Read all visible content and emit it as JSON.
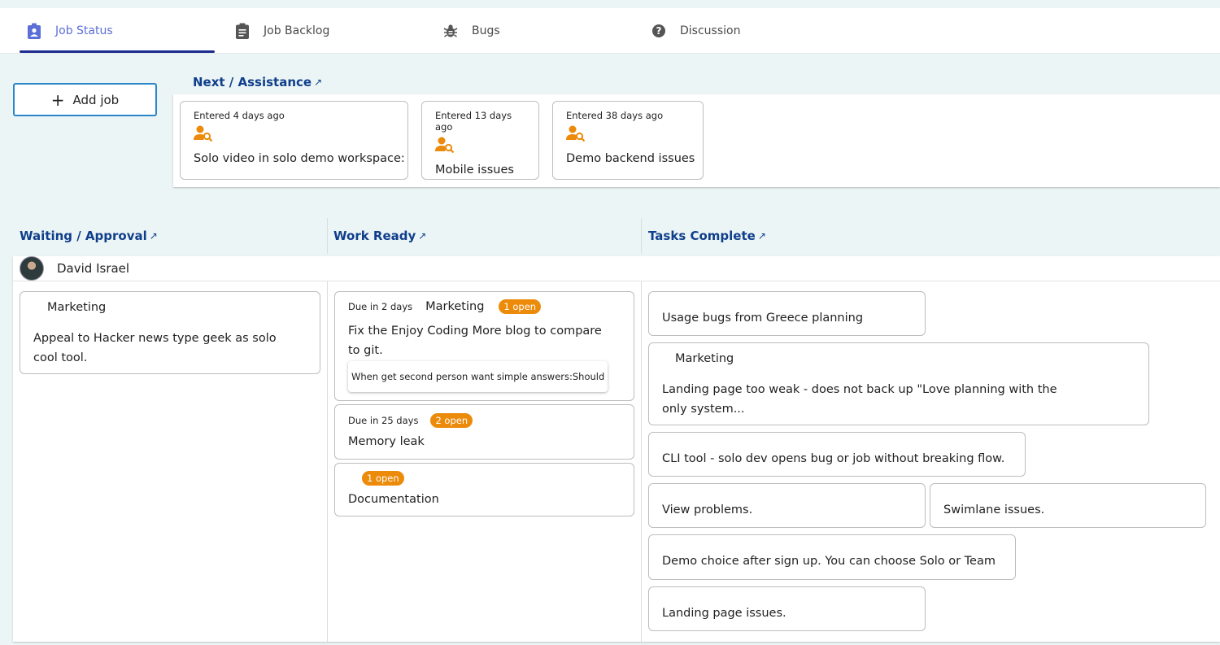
{
  "tabs": [
    {
      "label": "Job Status",
      "icon": "badge-icon",
      "active": true
    },
    {
      "label": "Job Backlog",
      "icon": "clipboard-icon",
      "active": false
    },
    {
      "label": "Bugs",
      "icon": "bug-icon",
      "active": false
    },
    {
      "label": "Discussion",
      "icon": "help-icon",
      "active": false
    }
  ],
  "add_job": {
    "label": "Add job"
  },
  "assistance": {
    "title": "Next / Assistance",
    "cards": [
      {
        "entered": "Entered 4 days ago",
        "title": "Solo video in solo demo workspace:"
      },
      {
        "entered": "Entered 13 days ago",
        "title": "Mobile issues"
      },
      {
        "entered": "Entered 38 days ago",
        "title": "Demo backend issues"
      }
    ]
  },
  "columns": [
    {
      "title": "Waiting / Approval"
    },
    {
      "title": "Work Ready"
    },
    {
      "title": "Tasks Complete"
    }
  ],
  "user": {
    "name": "David Israel"
  },
  "waiting": [
    {
      "tag": "Marketing",
      "title": "Appeal to Hacker news type geek as solo cool tool."
    }
  ],
  "work_ready": [
    {
      "due": "Due in 2 days",
      "tag": "Marketing",
      "badge": "1 open",
      "title": "Fix the Enjoy Coding More blog to compare to git.",
      "note": "When get second person want simple answers:Should I..."
    },
    {
      "due": "Due in 25 days",
      "badge": "2 open",
      "title": "Memory leak"
    },
    {
      "badge": "1 open",
      "title": "Documentation"
    }
  ],
  "complete": [
    {
      "title": "Usage bugs from Greece planning"
    },
    {
      "tag": "Marketing",
      "title": "Landing page too weak - does not back up \"Love planning with the only system..."
    },
    {
      "title": "CLI tool - solo dev opens bug or job without breaking flow."
    },
    {
      "title": "View problems."
    },
    {
      "title": "Swimlane issues."
    },
    {
      "title": "Demo choice after sign up. You can choose Solo or Team"
    },
    {
      "title": "Landing page issues."
    }
  ],
  "colors": {
    "accent": "#5b6fd6",
    "link": "#0f3f8c",
    "badge": "#ec8a0a",
    "person_icon": "#ec8a0a"
  }
}
